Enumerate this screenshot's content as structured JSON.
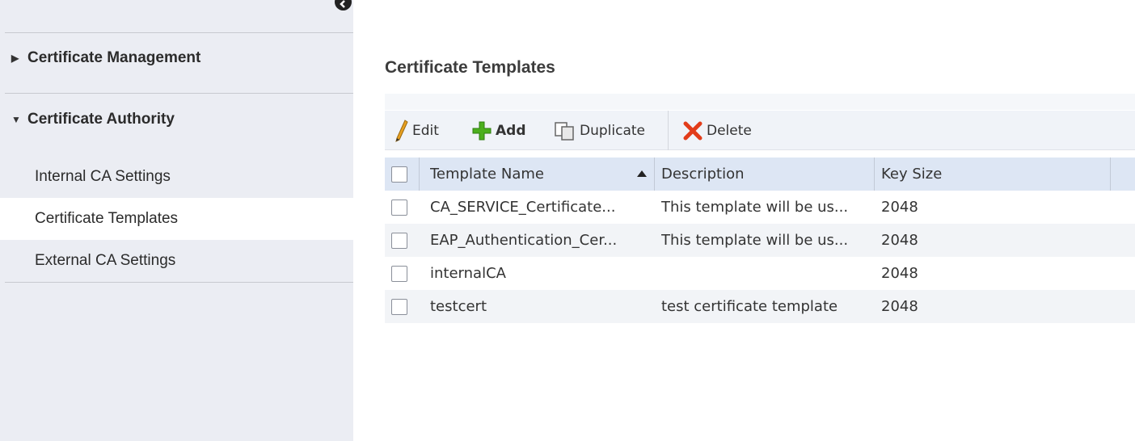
{
  "sidebar": {
    "groups": [
      {
        "label": "Certificate Management",
        "expanded": false
      },
      {
        "label": "Certificate Authority",
        "expanded": true
      }
    ],
    "items": [
      {
        "label": "Internal CA Settings",
        "selected": false
      },
      {
        "label": "Certificate Templates",
        "selected": true
      },
      {
        "label": "External CA Settings",
        "selected": false
      }
    ]
  },
  "main": {
    "title": "Certificate Templates",
    "toolbar": {
      "edit": "Edit",
      "add": "Add",
      "duplicate": "Duplicate",
      "delete": "Delete"
    },
    "table": {
      "columns": [
        "Template Name",
        "Description",
        "Key Size"
      ],
      "sort": {
        "column": "Template Name",
        "direction": "ascending"
      },
      "rows": [
        {
          "name": "CA_SERVICE_Certificate...",
          "description": "This template will be us...",
          "key_size": "2048"
        },
        {
          "name": "EAP_Authentication_Cer...",
          "description": "This template will be us...",
          "key_size": "2048"
        },
        {
          "name": "internalCA",
          "description": "",
          "key_size": "2048"
        },
        {
          "name": "testcert",
          "description": "test certificate template",
          "key_size": "2048"
        }
      ]
    }
  },
  "colors": {
    "sidebar_bg": "#ebedf3",
    "selected_item_bg": "#ffffff",
    "table_header_bg": "#dde6f4",
    "add_icon": "#4caf1e",
    "delete_icon": "#e23c1a",
    "edit_icon": "#e8a020"
  },
  "icons": {
    "collapse": "chevron-left-icon",
    "edit": "pencil-icon",
    "add": "plus-icon",
    "duplicate": "duplicate-icon",
    "delete": "x-icon"
  }
}
